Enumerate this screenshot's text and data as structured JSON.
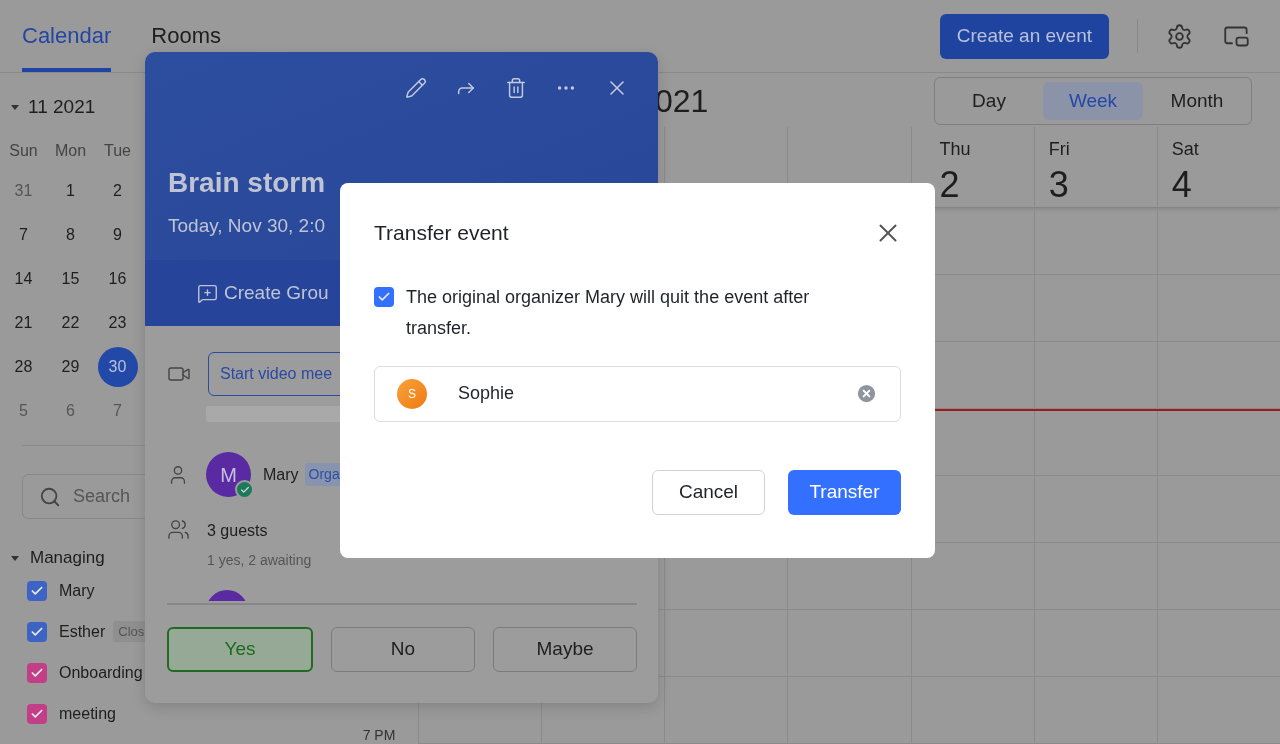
{
  "tabs": [
    {
      "label": "Calendar",
      "selected": true
    },
    {
      "label": "Rooms",
      "selected": false
    }
  ],
  "toolbar": {
    "create_button": "Create an event"
  },
  "mini_calendar": {
    "month": "11 2021",
    "expanded": true,
    "weekdays": [
      "Sun",
      "Mon",
      "Tue"
    ],
    "weeks": [
      [
        {
          "day": "31",
          "outside": true,
          "selected": false
        },
        {
          "day": "1",
          "outside": false,
          "selected": false
        },
        {
          "day": "2",
          "outside": false,
          "selected": false
        }
      ],
      [
        {
          "day": "7",
          "outside": false,
          "selected": false
        },
        {
          "day": "8",
          "outside": false,
          "selected": false
        },
        {
          "day": "9",
          "outside": false,
          "selected": false
        }
      ],
      [
        {
          "day": "14",
          "outside": false,
          "selected": false
        },
        {
          "day": "15",
          "outside": false,
          "selected": false
        },
        {
          "day": "16",
          "outside": false,
          "selected": false
        }
      ],
      [
        {
          "day": "21",
          "outside": false,
          "selected": false
        },
        {
          "day": "22",
          "outside": false,
          "selected": false
        },
        {
          "day": "23",
          "outside": false,
          "selected": false
        }
      ],
      [
        {
          "day": "28",
          "outside": false,
          "selected": false
        },
        {
          "day": "29",
          "outside": false,
          "selected": false
        },
        {
          "day": "30",
          "outside": false,
          "selected": true
        }
      ],
      [
        {
          "day": "5",
          "outside": true,
          "selected": false
        },
        {
          "day": "6",
          "outside": true,
          "selected": false
        },
        {
          "day": "7",
          "outside": true,
          "selected": false
        }
      ]
    ]
  },
  "search": {
    "placeholder": "Search"
  },
  "calendars": {
    "heading": "Managing",
    "expanded": true,
    "items": [
      {
        "name": "Mary",
        "checked": true,
        "color": "#3d64c4"
      },
      {
        "name": "Esther",
        "checked": true,
        "color": "#3d64c4",
        "badge": "Clos"
      },
      {
        "name": "Onboarding",
        "checked": true,
        "color": "#c23f87"
      },
      {
        "name": "meeting",
        "checked": true,
        "color": "#c23f87"
      }
    ]
  },
  "main": {
    "title": "021",
    "views": [
      {
        "label": "Day",
        "selected": false
      },
      {
        "label": "Week",
        "selected": true
      },
      {
        "label": "Month",
        "selected": false
      }
    ],
    "days": [
      {
        "weekday": "Thu",
        "date": "2"
      },
      {
        "weekday": "Fri",
        "date": "3"
      },
      {
        "weekday": "Sat",
        "date": "4"
      }
    ],
    "time_labels": [
      "7 PM"
    ]
  },
  "event_popover": {
    "title": "Brain storm",
    "time": "Today, Nov 30, 2:0",
    "group_button": "Create Grou",
    "video_button": "Start video mee",
    "organizer": {
      "initial": "M",
      "name": "Mary",
      "badge": "Orga",
      "accepted": true
    },
    "guests": {
      "count": "3 guests",
      "summary": "1 yes, 2 awaiting"
    },
    "responses": [
      {
        "label": "Yes",
        "selected": true
      },
      {
        "label": "No",
        "selected": false
      },
      {
        "label": "Maybe",
        "selected": false
      }
    ]
  },
  "dialog": {
    "title": "Transfer event",
    "checkbox": {
      "label": "The original organizer Mary will quit the event after transfer.",
      "checked": true
    },
    "recipient": {
      "initial": "S",
      "name": "Sophie"
    },
    "buttons": [
      {
        "label": "Cancel",
        "kind": "secondary"
      },
      {
        "label": "Transfer",
        "kind": "primary"
      }
    ]
  }
}
